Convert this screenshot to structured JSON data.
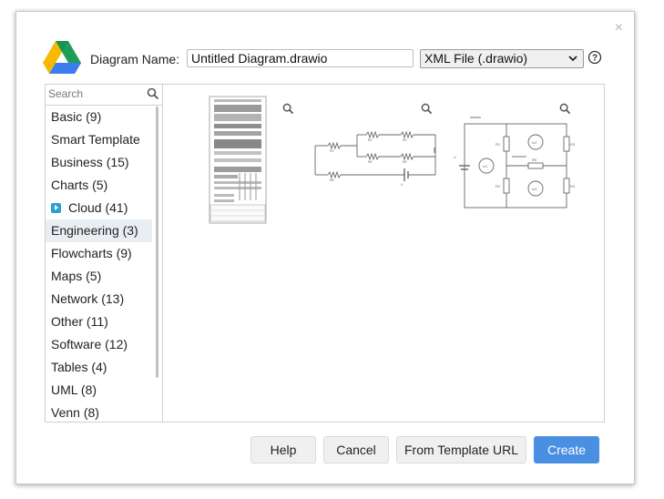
{
  "dialog": {
    "name_label": "Diagram Name:",
    "name_value": "Untitled Diagram.drawio",
    "format_selected": "XML File (.drawio)",
    "close_glyph": "×",
    "help_glyph": "?"
  },
  "sidebar": {
    "search_placeholder": "Search",
    "categories": [
      {
        "label": "Basic (9)"
      },
      {
        "label": "Smart Template"
      },
      {
        "label": "Business (15)"
      },
      {
        "label": "Charts (5)"
      },
      {
        "label": "Cloud (41)",
        "icon": "cloud-badge-icon"
      },
      {
        "label": "Engineering (3)",
        "selected": true
      },
      {
        "label": "Flowcharts (9)"
      },
      {
        "label": "Maps (5)"
      },
      {
        "label": "Network (13)"
      },
      {
        "label": "Other (11)"
      },
      {
        "label": "Software (12)"
      },
      {
        "label": "Tables (4)"
      },
      {
        "label": "UML (8)"
      },
      {
        "label": "Venn (8)"
      }
    ]
  },
  "templates": [
    {
      "icon": "rack-cabinet-thumbnail"
    },
    {
      "icon": "resistor-circuit-thumbnail"
    },
    {
      "icon": "mesh-circuit-thumbnail"
    }
  ],
  "buttons": {
    "help": "Help",
    "cancel": "Cancel",
    "from_template_url": "From Template URL",
    "create": "Create"
  },
  "colors": {
    "accent": "#4a90e2",
    "selected_bg": "#e9eef3"
  }
}
